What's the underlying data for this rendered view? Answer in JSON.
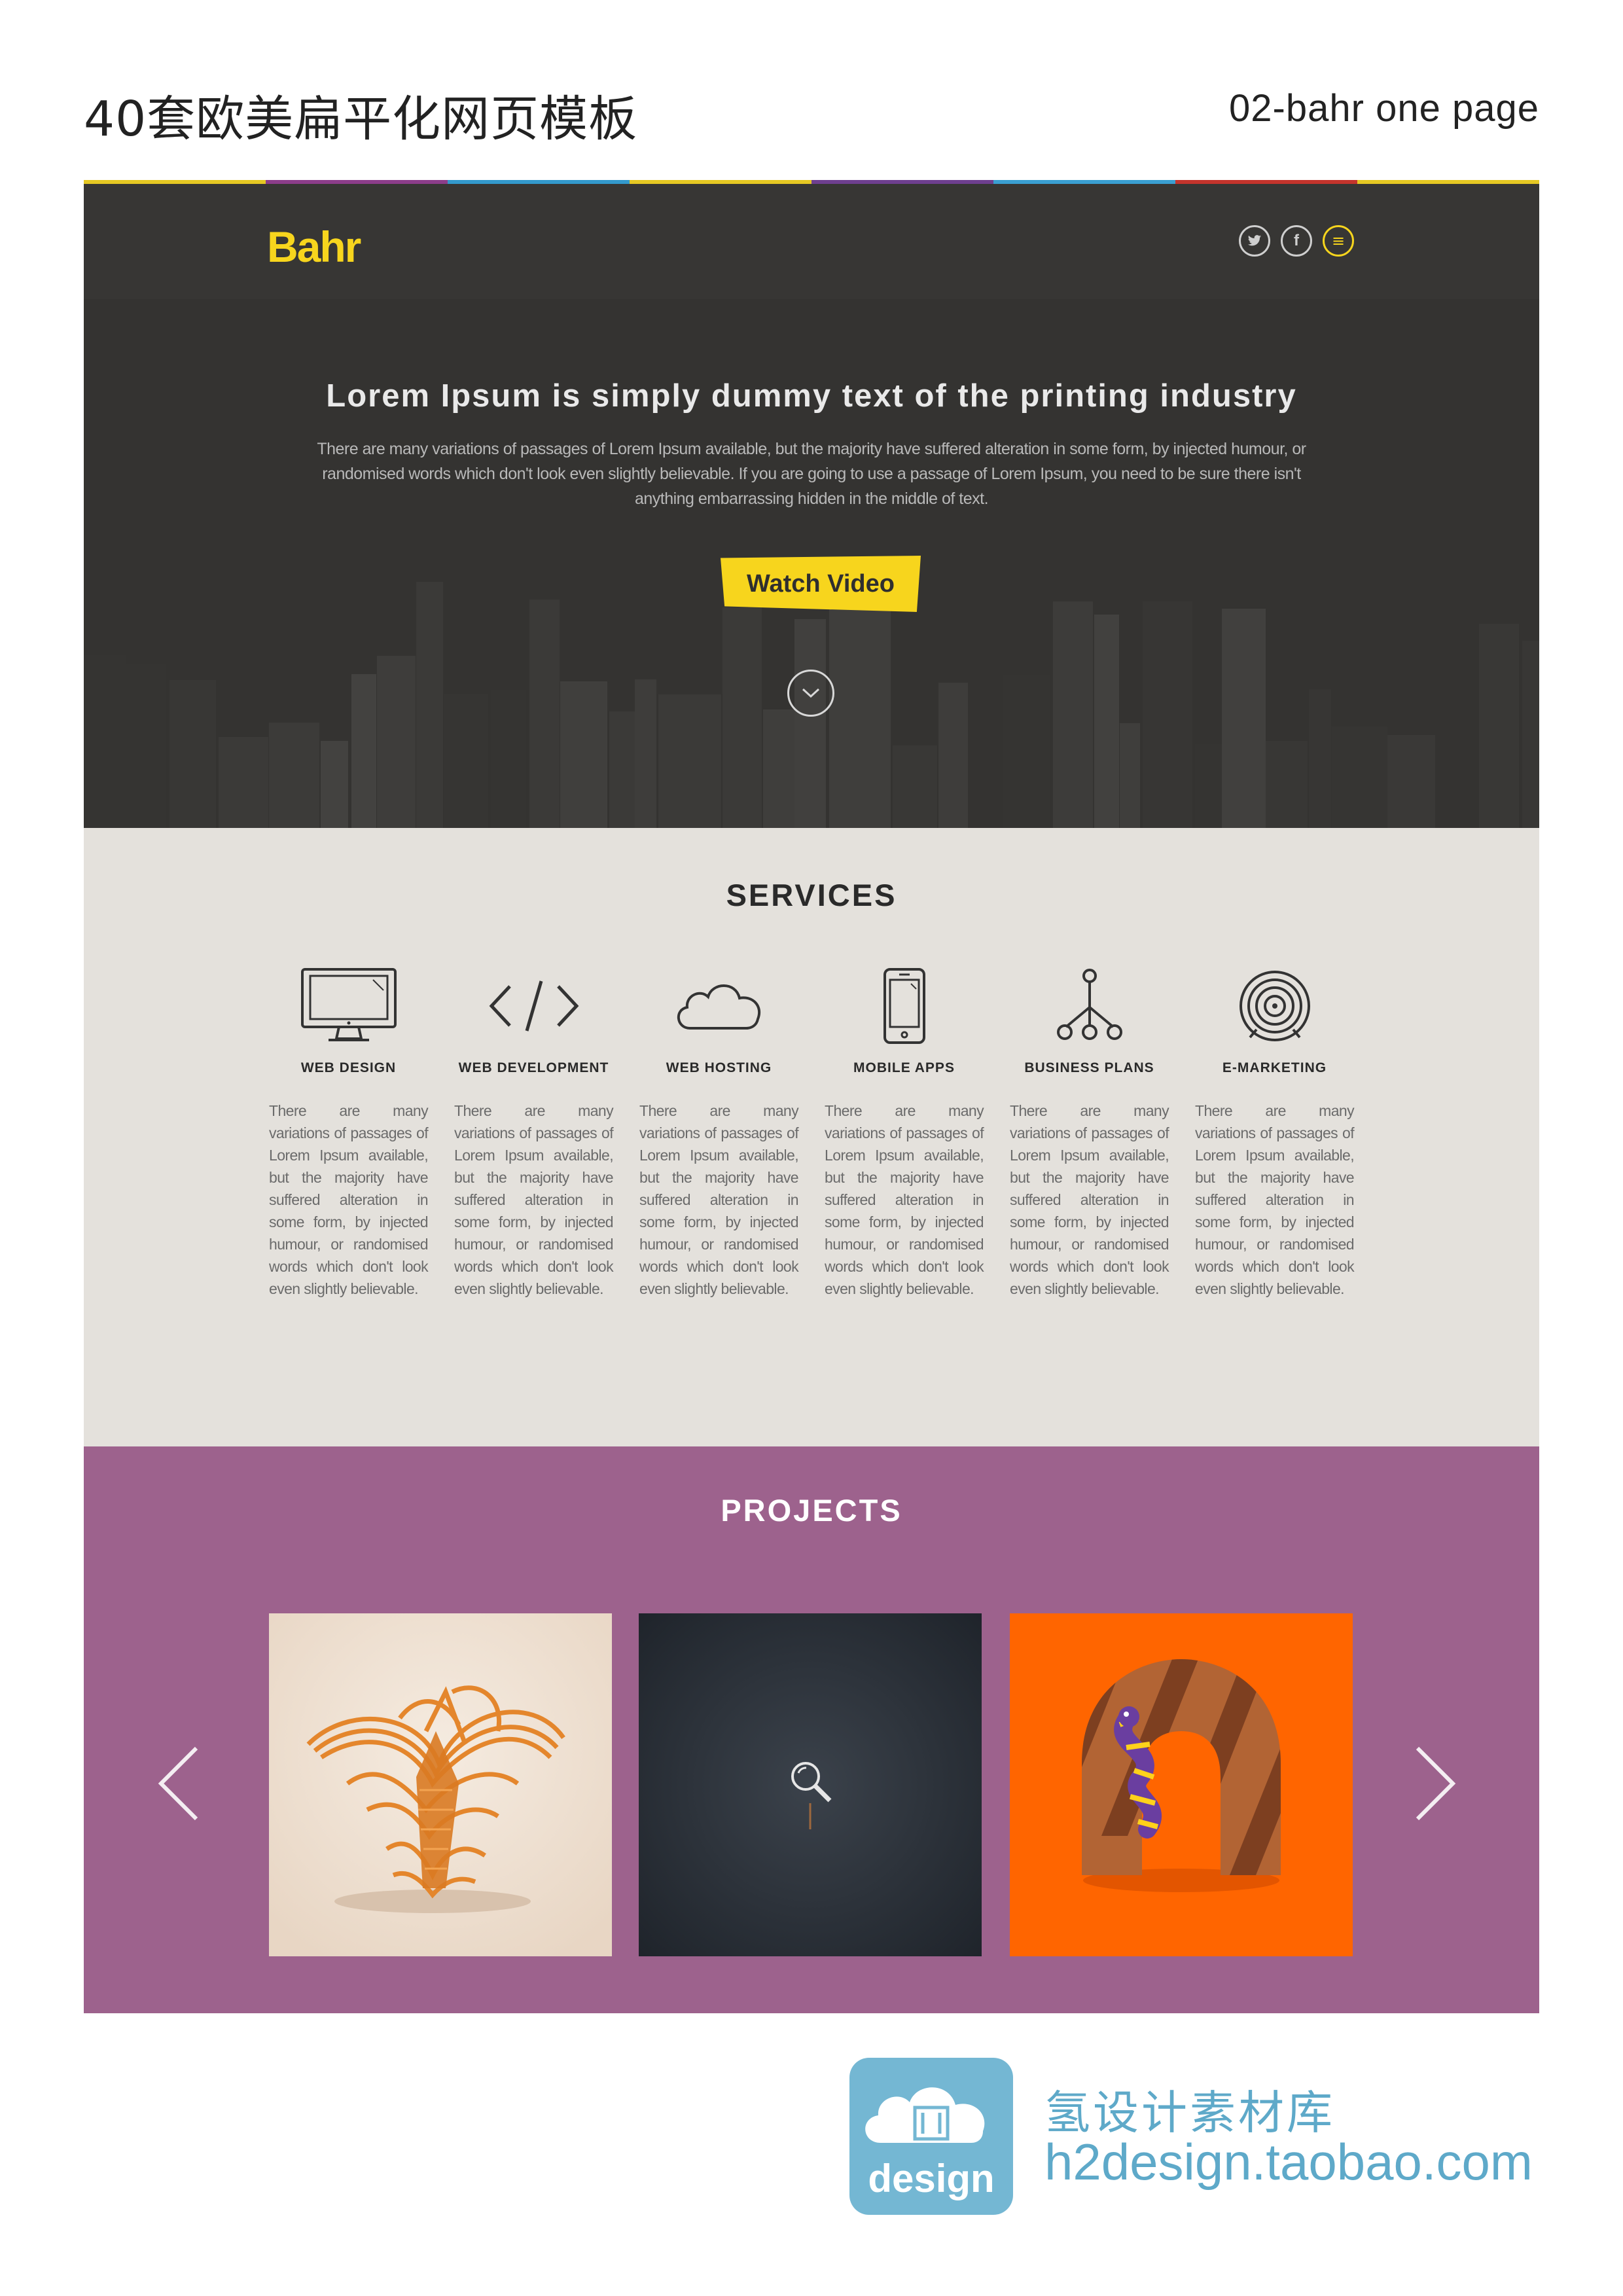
{
  "sheet": {
    "title": "40套欧美扁平化网页模板",
    "subtitle": "02-bahr one page"
  },
  "colors": {
    "accent_yellow": "#f7d51d",
    "header_bg": "#373634",
    "hero_bg": "#343331",
    "services_bg": "#e4e1dc",
    "projects_bg": "#9d628d",
    "strip": [
      "#e5c823",
      "#8c3d8a",
      "#3399cc",
      "#e5c823",
      "#6e3f8f",
      "#3a9fd1",
      "#c4342c",
      "#e5c823"
    ]
  },
  "header": {
    "logo": "Bahr",
    "social": [
      {
        "icon": "twitter-icon",
        "glyph": "t"
      },
      {
        "icon": "facebook-icon",
        "glyph": "f"
      },
      {
        "icon": "menu-icon",
        "glyph": "≡"
      }
    ]
  },
  "hero": {
    "title": "Lorem Ipsum is simply dummy text of the printing industry",
    "text": "There are many variations of passages of Lorem Ipsum available, but the majority have suffered alteration in some form, by injected humour, or randomised words which don't look even slightly believable. If you are going to use a passage of Lorem Ipsum, you need to be sure there isn't anything embarrassing hidden in the middle of text.",
    "button": "Watch Video",
    "scroll_icon": "chevron-down-icon"
  },
  "services": {
    "title": "SERVICES",
    "items": [
      {
        "icon": "monitor-icon",
        "label": "WEB DESIGN",
        "text": "There are many variations of passages of Lorem Ipsum available, but the majority have suffered alteration in some form, by injected humour, or randomised words which don't look even slightly believable."
      },
      {
        "icon": "code-icon",
        "label": "WEB DEVELOPMENT",
        "text": "There are many variations of passages of Lorem Ipsum available, but the majority have suffered alteration in some form, by injected humour, or randomised words which don't look even slightly believable."
      },
      {
        "icon": "cloud-icon",
        "label": "WEB HOSTING",
        "text": "There are many variations of passages of Lorem Ipsum available, but the majority have suffered alteration in some form, by injected humour, or randomised words which don't look even slightly believable."
      },
      {
        "icon": "smartphone-icon",
        "label": "MOBILE APPS",
        "text": "There are many variations of passages of Lorem Ipsum available, but the majority have suffered alteration in some form, by injected humour, or randomised words which don't look even slightly believable."
      },
      {
        "icon": "hierarchy-icon",
        "label": "BUSINESS PLANS",
        "text": "There are many variations of passages of Lorem Ipsum available, but the majority have suffered alteration in some form, by injected humour, or randomised words which don't look even slightly believable."
      },
      {
        "icon": "target-icon",
        "label": "E-MARKETING",
        "text": "There are many variations of passages of Lorem Ipsum available, but the majority have suffered alteration in some form, by injected humour, or randomised words which don't look even slightly believable."
      }
    ]
  },
  "projects": {
    "title": "PROJECTS",
    "prev_icon": "chevron-left-icon",
    "next_icon": "chevron-right-icon",
    "items": [
      {
        "image": "orange-3d-sculpture"
      },
      {
        "image": "dark-night-photo",
        "overlay_icon": "zoom-icon"
      },
      {
        "image": "striped-arch-with-snake"
      }
    ]
  },
  "footer_brand": {
    "logo_word": "design",
    "name": "氢设计素材库",
    "url": "h2design.taobao.com"
  }
}
